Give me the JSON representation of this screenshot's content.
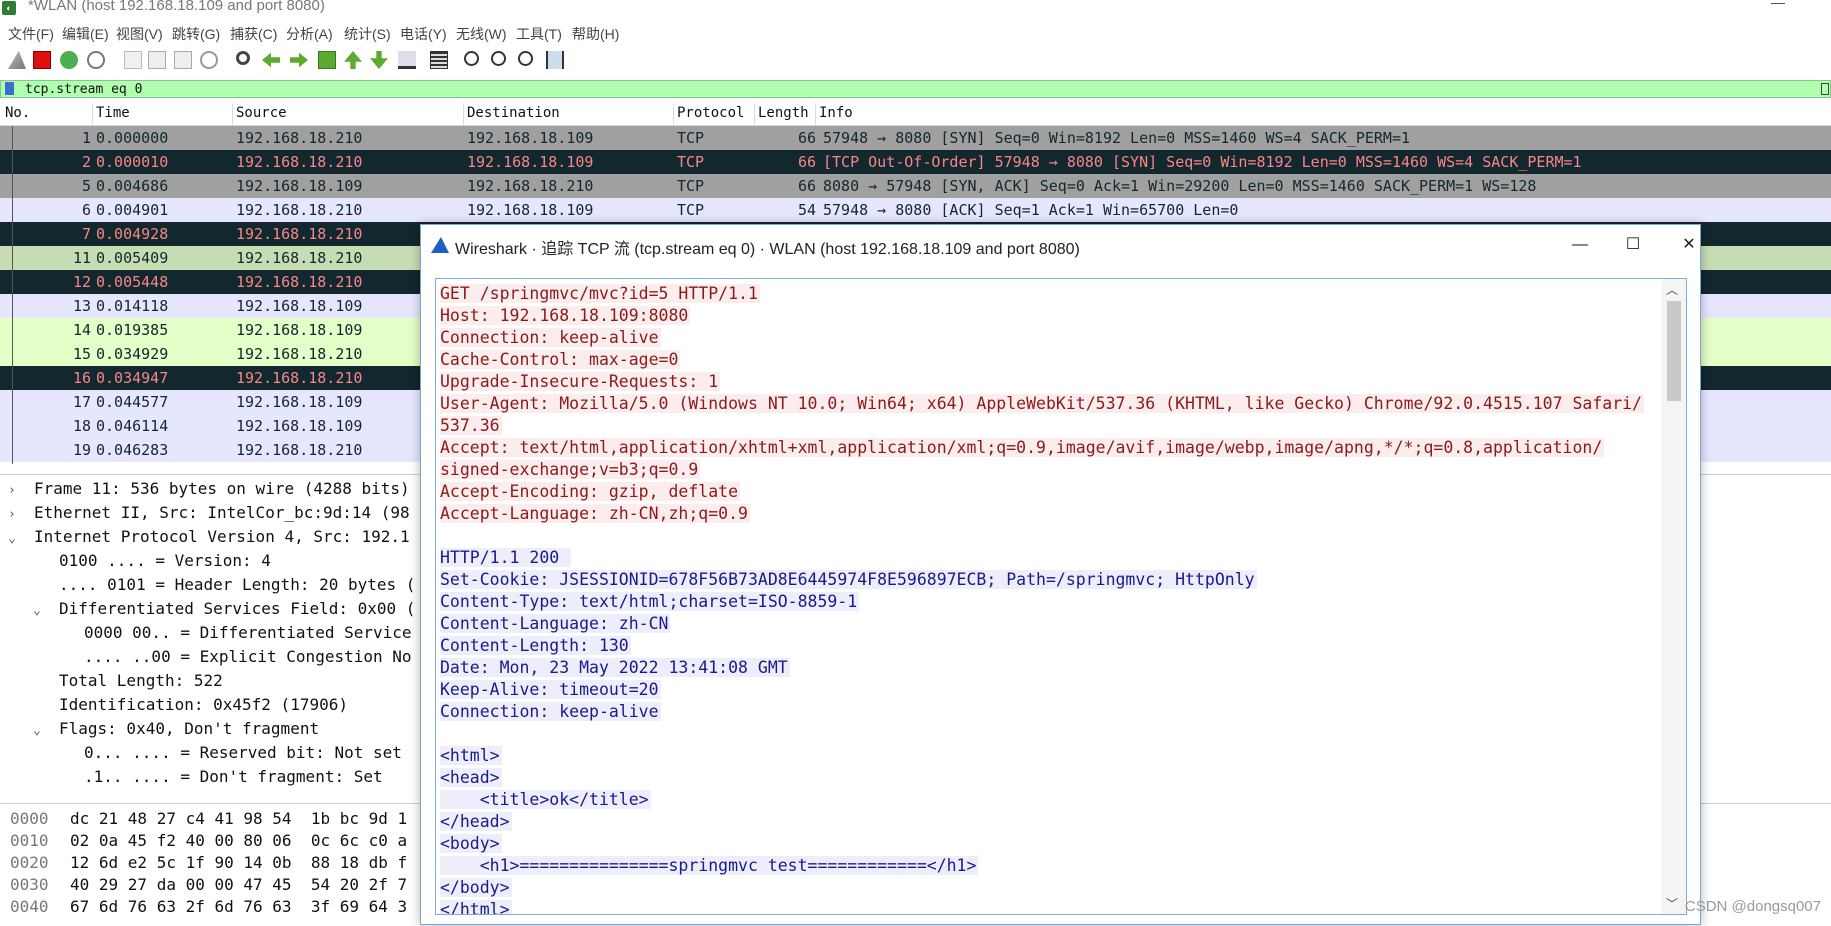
{
  "window": {
    "title": "*WLAN (host 192.168.18.109 and port 8080)",
    "icon_name": "wireshark-app-icon"
  },
  "menu": [
    "文件(F)",
    "编辑(E)",
    "视图(V)",
    "跳转(G)",
    "捕获(C)",
    "分析(A)",
    "统计(S)",
    "电话(Y)",
    "无线(W)",
    "工具(T)",
    "帮助(H)"
  ],
  "toolbar": [
    "shark-fin-start-icon",
    "stop-capture-icon",
    "restart-capture-icon",
    "capture-options-icon",
    "open-file-icon",
    "save-file-icon",
    "close-file-icon",
    "reload-icon",
    "find-packet-icon",
    "go-back-icon",
    "go-forward-icon",
    "go-to-packet-icon",
    "go-first-icon",
    "go-last-icon",
    "autoscroll-icon",
    "colorize-icon",
    "zoom-in-icon",
    "zoom-out-icon",
    "zoom-normal-icon",
    "resize-columns-icon"
  ],
  "filter": {
    "value": "tcp.stream eq 0"
  },
  "packet_list": {
    "columns": [
      "No.",
      "Time",
      "Source",
      "Destination",
      "Protocol",
      "Length",
      "Info"
    ],
    "rows": [
      {
        "no": "1",
        "time": "0.000000",
        "src": "192.168.18.210",
        "dst": "192.168.18.109",
        "proto": "TCP",
        "len": "66",
        "info": "57948 → 8080 [SYN] Seq=0 Win=8192 Len=0 MSS=1460 WS=4 SACK_PERM=1",
        "bg": "#a0a0a0",
        "fg": "#12272e"
      },
      {
        "no": "2",
        "time": "0.000010",
        "src": "192.168.18.210",
        "dst": "192.168.18.109",
        "proto": "TCP",
        "len": "66",
        "info": "[TCP Out-Of-Order] 57948 → 8080 [SYN] Seq=0 Win=8192 Len=0 MSS=1460 WS=4 SACK_PERM=1",
        "bg": "#12272e",
        "fg": "#f78787"
      },
      {
        "no": "5",
        "time": "0.004686",
        "src": "192.168.18.109",
        "dst": "192.168.18.210",
        "proto": "TCP",
        "len": "66",
        "info": "8080 → 57948 [SYN, ACK] Seq=0 Ack=1 Win=29200 Len=0 MSS=1460 SACK_PERM=1 WS=128",
        "bg": "#a0a0a0",
        "fg": "#12272e"
      },
      {
        "no": "6",
        "time": "0.004901",
        "src": "192.168.18.210",
        "dst": "192.168.18.109",
        "proto": "TCP",
        "len": "54",
        "info": "57948 → 8080 [ACK] Seq=1 Ack=1 Win=65700 Len=0",
        "bg": "#e7e6ff",
        "fg": "#12272e"
      },
      {
        "no": "7",
        "time": "0.004928",
        "src": "192.168.18.210",
        "dst": "",
        "proto": "",
        "len": "",
        "info": "",
        "bg": "#12272e",
        "fg": "#f78787"
      },
      {
        "no": "11",
        "time": "0.005409",
        "src": "192.168.18.210",
        "dst": "",
        "proto": "",
        "len": "",
        "info": "",
        "bg": "#c8dcb4",
        "fg": "#12272e"
      },
      {
        "no": "12",
        "time": "0.005448",
        "src": "192.168.18.210",
        "dst": "",
        "proto": "",
        "len": "",
        "info": "",
        "bg": "#12272e",
        "fg": "#f78787"
      },
      {
        "no": "13",
        "time": "0.014118",
        "src": "192.168.18.109",
        "dst": "",
        "proto": "",
        "len": "",
        "info": "",
        "bg": "#e7e6ff",
        "fg": "#12272e"
      },
      {
        "no": "14",
        "time": "0.019385",
        "src": "192.168.18.109",
        "dst": "",
        "proto": "",
        "len": "",
        "info": "",
        "bg": "#e4ffc7",
        "fg": "#12272e"
      },
      {
        "no": "15",
        "time": "0.034929",
        "src": "192.168.18.210",
        "dst": "",
        "proto": "",
        "len": "",
        "info": "",
        "bg": "#e4ffc7",
        "fg": "#12272e"
      },
      {
        "no": "16",
        "time": "0.034947",
        "src": "192.168.18.210",
        "dst": "",
        "proto": "",
        "len": "",
        "info": "",
        "bg": "#12272e",
        "fg": "#f78787"
      },
      {
        "no": "17",
        "time": "0.044577",
        "src": "192.168.18.109",
        "dst": "",
        "proto": "",
        "len": "",
        "info": "",
        "bg": "#e7e6ff",
        "fg": "#12272e"
      },
      {
        "no": "18",
        "time": "0.046114",
        "src": "192.168.18.109",
        "dst": "",
        "proto": "",
        "len": "",
        "info": "",
        "bg": "#e7e6ff",
        "fg": "#12272e"
      },
      {
        "no": "19",
        "time": "0.046283",
        "src": "192.168.18.210",
        "dst": "",
        "proto": "",
        "len": "",
        "info": "",
        "bg": "#e7e6ff",
        "fg": "#12272e"
      }
    ]
  },
  "details": [
    {
      "indent": 0,
      "toggle": "›",
      "text": "Frame 11: 536 bytes on wire (4288 bits)"
    },
    {
      "indent": 0,
      "toggle": "›",
      "text": "Ethernet II, Src: IntelCor_bc:9d:14 (98"
    },
    {
      "indent": 0,
      "toggle": "⌄",
      "text": "Internet Protocol Version 4, Src: 192.1"
    },
    {
      "indent": 1,
      "toggle": "",
      "text": "0100 .... = Version: 4"
    },
    {
      "indent": 1,
      "toggle": "",
      "text": ".... 0101 = Header Length: 20 bytes ("
    },
    {
      "indent": 1,
      "toggle": "⌄",
      "text": "Differentiated Services Field: 0x00 ("
    },
    {
      "indent": 2,
      "toggle": "",
      "text": "0000 00.. = Differentiated Service"
    },
    {
      "indent": 2,
      "toggle": "",
      "text": ".... ..00 = Explicit Congestion No"
    },
    {
      "indent": 1,
      "toggle": "",
      "text": "Total Length: 522"
    },
    {
      "indent": 1,
      "toggle": "",
      "text": "Identification: 0x45f2 (17906)"
    },
    {
      "indent": 1,
      "toggle": "⌄",
      "text": "Flags: 0x40, Don't fragment"
    },
    {
      "indent": 2,
      "toggle": "",
      "text": "0... .... = Reserved bit: Not set"
    },
    {
      "indent": 2,
      "toggle": "",
      "text": ".1.. .... = Don't fragment: Set"
    }
  ],
  "bytes": [
    {
      "offset": "0000",
      "hex": "dc 21 48 27 c4 41 98 54  1b bc 9d 1"
    },
    {
      "offset": "0010",
      "hex": "02 0a 45 f2 40 00 80 06  0c 6c c0 a"
    },
    {
      "offset": "0020",
      "hex": "12 6d e2 5c 1f 90 14 0b  88 18 db f"
    },
    {
      "offset": "0030",
      "hex": "40 29 27 da 00 00 47 45  54 20 2f 7"
    },
    {
      "offset": "0040",
      "hex": "67 6d 76 63 2f 6d 76 63  3f 69 64 3"
    }
  ],
  "dialog": {
    "title": "Wireshark · 追踪 TCP 流 (tcp.stream eq 0) · WLAN (host 192.168.18.109 and port 8080)",
    "minimize": "—",
    "maximize": "☐",
    "close": "✕",
    "client_color": "#8b1a1a",
    "server_color": "#1a1a8b",
    "request": [
      "GET /springmvc/mvc?id=5 HTTP/1.1",
      "Host: 192.168.18.109:8080",
      "Connection: keep-alive",
      "Cache-Control: max-age=0",
      "Upgrade-Insecure-Requests: 1",
      "User-Agent: Mozilla/5.0 (Windows NT 10.0; Win64; x64) AppleWebKit/537.36 (KHTML, like Gecko) Chrome/92.0.4515.107 Safari/",
      "537.36",
      "Accept: text/html,application/xhtml+xml,application/xml;q=0.9,image/avif,image/webp,image/apng,*/*;q=0.8,application/",
      "signed-exchange;v=b3;q=0.9",
      "Accept-Encoding: gzip, deflate",
      "Accept-Language: zh-CN,zh;q=0.9"
    ],
    "response_headers": [
      "HTTP/1.1 200 ",
      "Set-Cookie: JSESSIONID=678F56B73AD8E6445974F8E596897ECB; Path=/springmvc; HttpOnly",
      "Content-Type: text/html;charset=ISO-8859-1",
      "Content-Language: zh-CN",
      "Content-Length: 130",
      "Date: Mon, 23 May 2022 13:41:08 GMT",
      "Keep-Alive: timeout=20",
      "Connection: keep-alive"
    ],
    "response_body": [
      "<html>",
      "<head>",
      "    <title>ok</title>",
      "</head>",
      "<body>",
      "    <h1>===============springmvc test============</h1>",
      "</body>",
      "</html>"
    ]
  },
  "watermark": "CSDN @dongsq007"
}
